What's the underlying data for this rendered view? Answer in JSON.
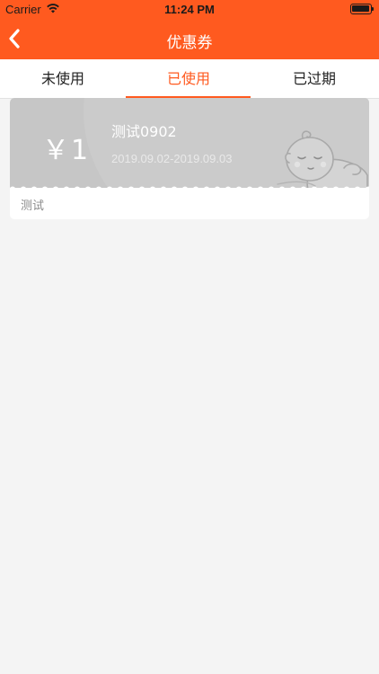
{
  "status_bar": {
    "carrier": "Carrier",
    "time": "11:24 PM"
  },
  "nav": {
    "title": "优惠券",
    "back_icon": "chevron-left-icon"
  },
  "tabs": [
    {
      "label": "未使用",
      "active": false
    },
    {
      "label": "已使用",
      "active": true
    },
    {
      "label": "已过期",
      "active": false
    }
  ],
  "coupons": [
    {
      "amount": "￥1",
      "name": "测试0902",
      "dates": "2019.09.02-2019.09.03",
      "description": "测试",
      "illustration": "sleeping-baby-icon"
    }
  ],
  "colors": {
    "accent": "#ff5a1f",
    "coupon_used_bg": "#c6c6c6",
    "page_bg": "#f4f4f4"
  }
}
